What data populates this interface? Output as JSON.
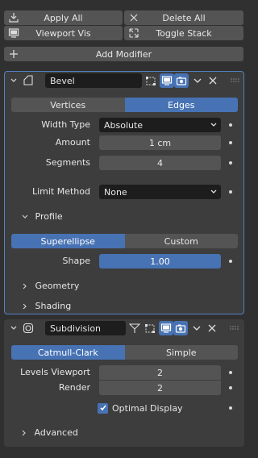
{
  "toolbar": {
    "apply_all": "Apply All",
    "delete_all": "Delete All",
    "viewport_vis": "Viewport Vis",
    "toggle_stack": "Toggle Stack",
    "add_modifier": "Add Modifier"
  },
  "bevel": {
    "name": "Bevel",
    "affect_tabs": [
      "Vertices",
      "Edges"
    ],
    "affect_selected": "Edges",
    "width_type_label": "Width Type",
    "width_type_value": "Absolute",
    "amount_label": "Amount",
    "amount_value": "1 cm",
    "segments_label": "Segments",
    "segments_value": "4",
    "limit_method_label": "Limit Method",
    "limit_method_value": "None",
    "profile_label": "Profile",
    "profile_tabs": [
      "Superellipse",
      "Custom"
    ],
    "profile_selected": "Superellipse",
    "shape_label": "Shape",
    "shape_value": "1.00",
    "shape_fill": 1.0,
    "geometry_label": "Geometry",
    "shading_label": "Shading"
  },
  "subdivision": {
    "name": "Subdivision",
    "type_tabs": [
      "Catmull-Clark",
      "Simple"
    ],
    "type_selected": "Catmull-Clark",
    "levels_viewport_label": "Levels Viewport",
    "levels_viewport_value": "2",
    "render_label": "Render",
    "render_value": "2",
    "optimal_display_label": "Optimal Display",
    "optimal_display_checked": true,
    "advanced_label": "Advanced"
  },
  "colors": {
    "accent": "#4772b3",
    "active_outline": "#5680c2",
    "panel_bg": "#3d3d3d",
    "window_bg": "#303030"
  }
}
